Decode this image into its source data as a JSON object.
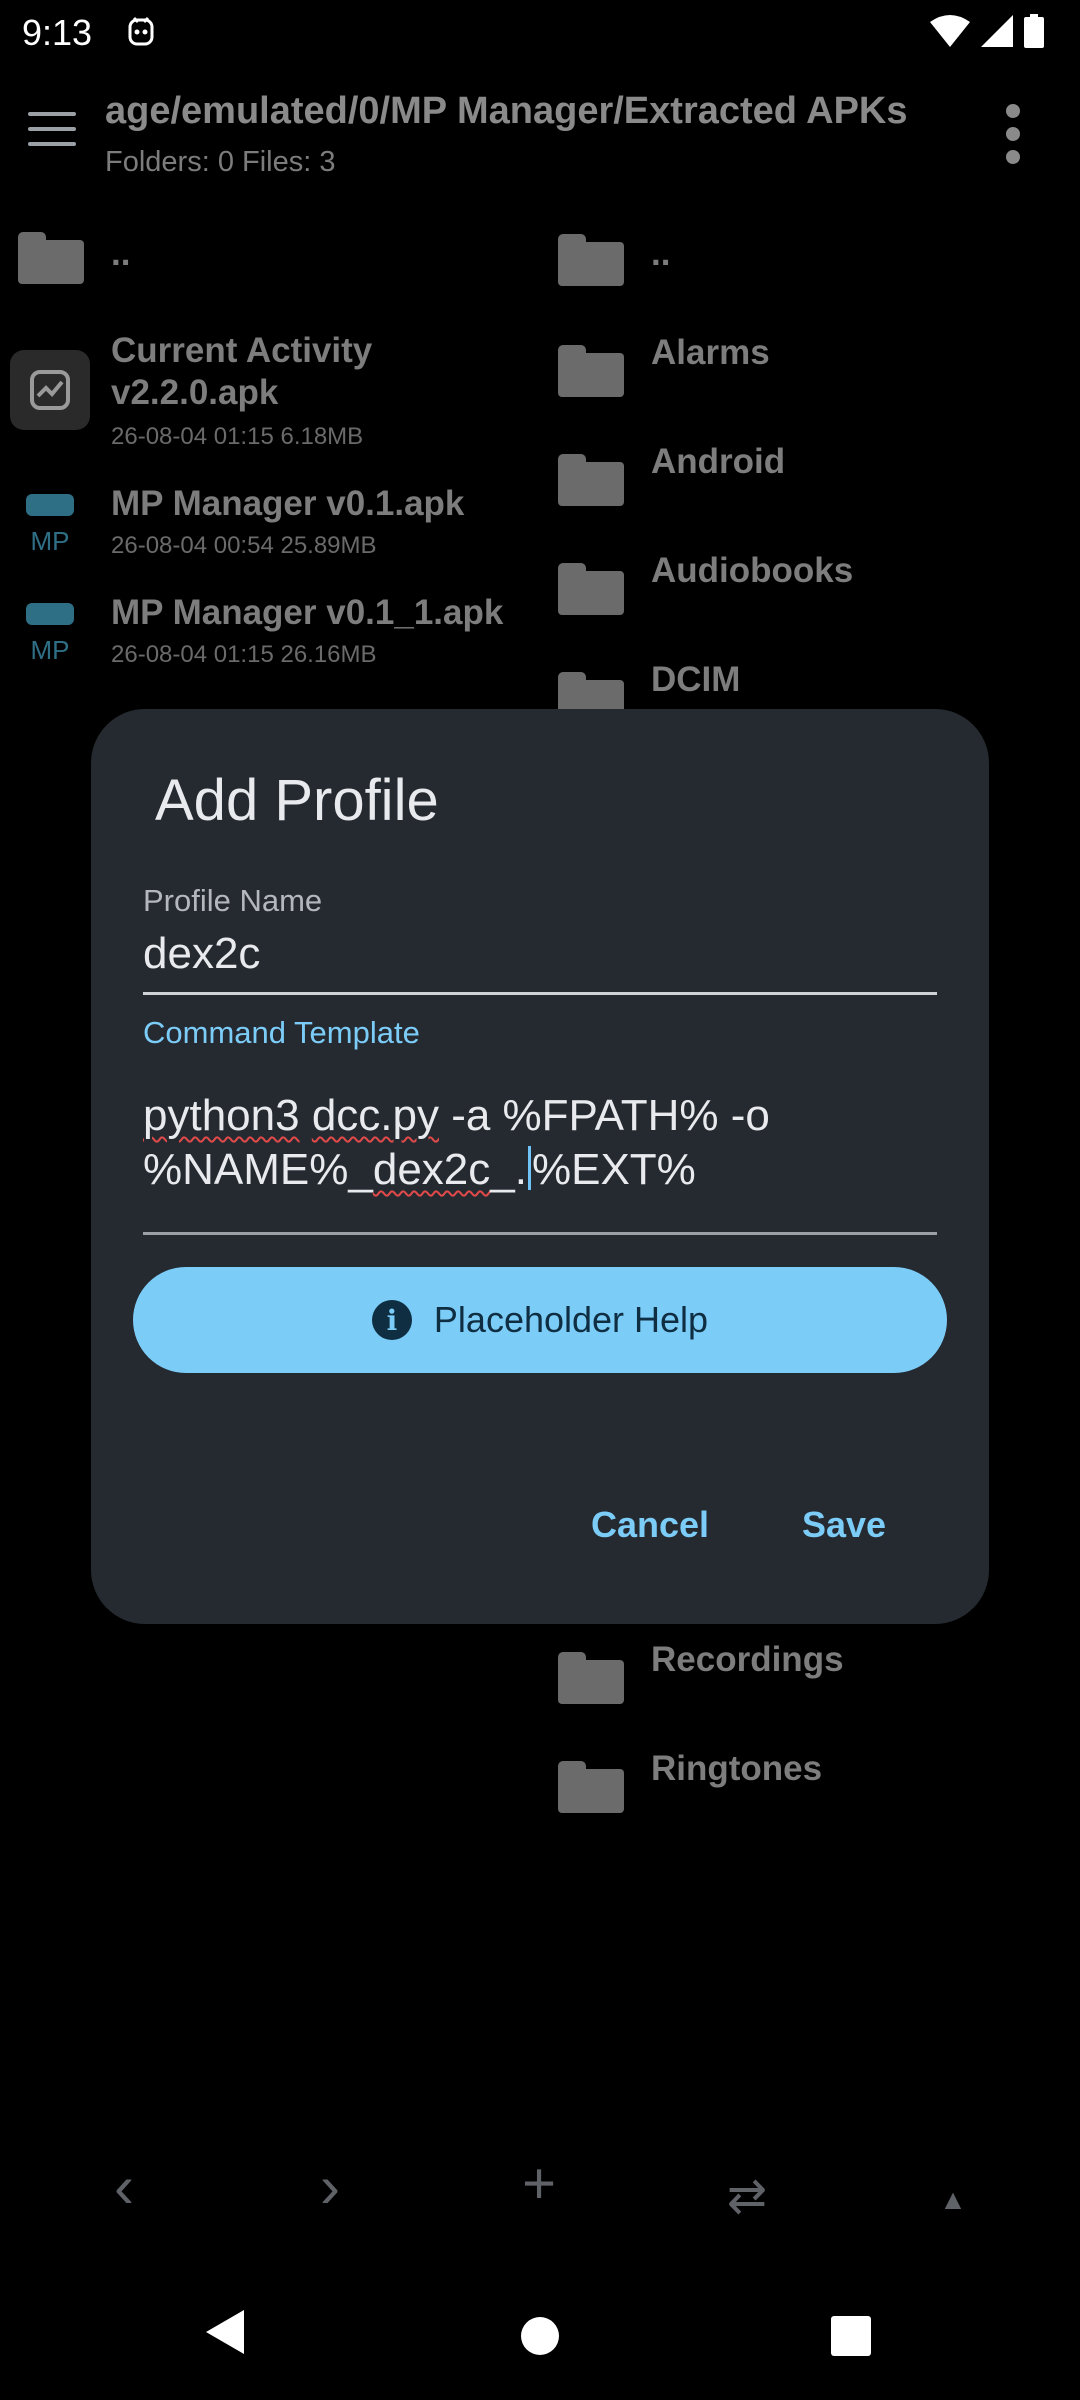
{
  "status_bar": {
    "time": "9:13"
  },
  "app_bar": {
    "path": "age/emulated/0/MP Manager/Extracted APKs",
    "summary": "Folders: 0 Files: 3"
  },
  "left_pane": {
    "parent": "..",
    "files": [
      {
        "name_line1": "Current Activity",
        "name_line2": "v2.2.0.apk",
        "meta": "26-08-04 01:15 6.18MB"
      },
      {
        "name_line1": "MP Manager v0.1.apk",
        "meta": "26-08-04 00:54 25.89MB"
      },
      {
        "name_line1": "MP Manager v0.1_1.apk",
        "meta": "26-08-04 01:15 26.16MB"
      }
    ]
  },
  "right_pane": {
    "folders_top": [
      "..",
      "Alarms",
      "Android",
      "Audiobooks",
      "DCIM"
    ],
    "folders_bottom": [
      "Recordings",
      "Ringtones"
    ]
  },
  "dialog": {
    "title": "Add Profile",
    "profile_name_label": "Profile Name",
    "profile_name_value": "dex2c",
    "command_label": "Command Template",
    "command_parts": {
      "w1": "python3",
      "s1": " ",
      "w2": "dcc.py",
      "s2": " -a %FPATH% -o\n%NAME%_",
      "w3": "dex2c",
      "s3": "_.",
      "s4": "%EXT%"
    },
    "help_button": "Placeholder Help",
    "cancel": "Cancel",
    "save": "Save"
  },
  "toolbar": {
    "back": "‹",
    "forward": "›",
    "add": "+",
    "swap": "⇄",
    "up": "▲"
  },
  "colors": {
    "accent": "#7cccf8",
    "dialog_bg": "#252a31",
    "spell_error": "#e24a4a"
  }
}
